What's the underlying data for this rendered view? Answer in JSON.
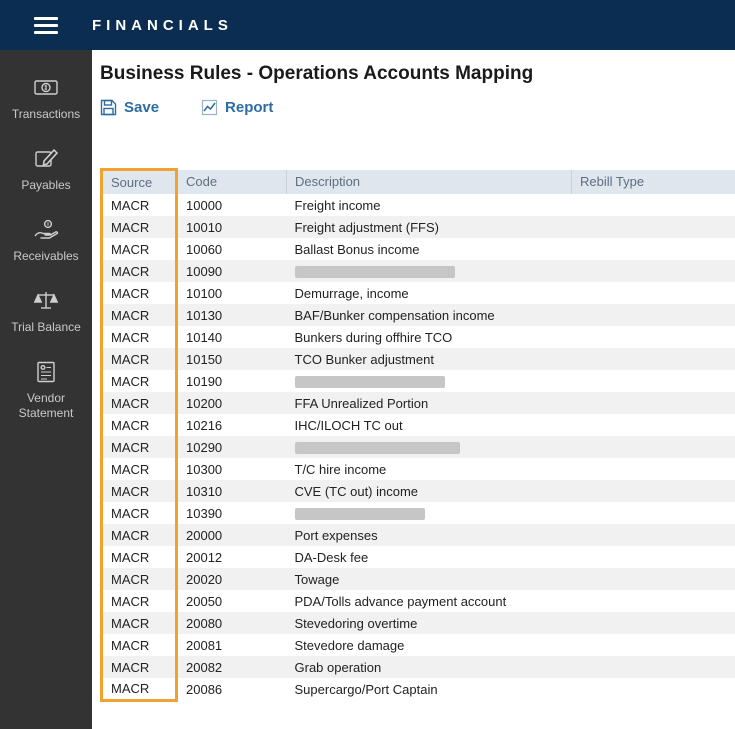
{
  "topbar": {
    "title": "FINANCIALS"
  },
  "sidebar": {
    "items": [
      {
        "label": "Transactions",
        "icon": "transactions-money-icon"
      },
      {
        "label": "Payables",
        "icon": "payables-edit-icon"
      },
      {
        "label": "Receivables",
        "icon": "receivables-hand-coin-icon"
      },
      {
        "label": "Trial Balance",
        "icon": "trial-balance-scale-icon"
      },
      {
        "label": "Vendor Statement",
        "icon": "vendor-statement-document-icon"
      }
    ]
  },
  "main": {
    "title": "Business Rules - Operations Accounts Mapping",
    "toolbar": {
      "save_label": "Save",
      "report_label": "Report"
    },
    "table": {
      "headers": [
        "Source",
        "Code",
        "Description",
        "Rebill Type"
      ],
      "rows": [
        {
          "source": "MACR",
          "code": "10000",
          "description": "Freight income",
          "rebill_type": "",
          "redacted": false
        },
        {
          "source": "MACR",
          "code": "10010",
          "description": "Freight adjustment (FFS)",
          "rebill_type": "",
          "redacted": false
        },
        {
          "source": "MACR",
          "code": "10060",
          "description": "Ballast Bonus income",
          "rebill_type": "",
          "redacted": false
        },
        {
          "source": "MACR",
          "code": "10090",
          "description": "",
          "rebill_type": "",
          "redacted": true,
          "redacted_width": 160
        },
        {
          "source": "MACR",
          "code": "10100",
          "description": "Demurrage, income",
          "rebill_type": "",
          "redacted": false
        },
        {
          "source": "MACR",
          "code": "10130",
          "description": "BAF/Bunker compensation income",
          "rebill_type": "",
          "redacted": false
        },
        {
          "source": "MACR",
          "code": "10140",
          "description": "Bunkers during offhire TCO",
          "rebill_type": "",
          "redacted": false
        },
        {
          "source": "MACR",
          "code": "10150",
          "description": "TCO Bunker adjustment",
          "rebill_type": "",
          "redacted": false
        },
        {
          "source": "MACR",
          "code": "10190",
          "description": "",
          "rebill_type": "",
          "redacted": true,
          "redacted_width": 150
        },
        {
          "source": "MACR",
          "code": "10200",
          "description": "FFA Unrealized Portion",
          "rebill_type": "",
          "redacted": false
        },
        {
          "source": "MACR",
          "code": "10216",
          "description": "IHC/ILOCH TC out",
          "rebill_type": "",
          "redacted": false
        },
        {
          "source": "MACR",
          "code": "10290",
          "description": "",
          "rebill_type": "",
          "redacted": true,
          "redacted_width": 165
        },
        {
          "source": "MACR",
          "code": "10300",
          "description": "T/C hire income",
          "rebill_type": "",
          "redacted": false
        },
        {
          "source": "MACR",
          "code": "10310",
          "description": "CVE (TC out) income",
          "rebill_type": "",
          "redacted": false
        },
        {
          "source": "MACR",
          "code": "10390",
          "description": "",
          "rebill_type": "",
          "redacted": true,
          "redacted_width": 130
        },
        {
          "source": "MACR",
          "code": "20000",
          "description": "Port expenses",
          "rebill_type": "",
          "redacted": false
        },
        {
          "source": "MACR",
          "code": "20012",
          "description": "DA-Desk fee",
          "rebill_type": "",
          "redacted": false
        },
        {
          "source": "MACR",
          "code": "20020",
          "description": "Towage",
          "rebill_type": "",
          "redacted": false
        },
        {
          "source": "MACR",
          "code": "20050",
          "description": "PDA/Tolls advance payment account",
          "rebill_type": "",
          "redacted": false
        },
        {
          "source": "MACR",
          "code": "20080",
          "description": "Stevedoring overtime",
          "rebill_type": "",
          "redacted": false
        },
        {
          "source": "MACR",
          "code": "20081",
          "description": "Stevedore damage",
          "rebill_type": "",
          "redacted": false
        },
        {
          "source": "MACR",
          "code": "20082",
          "description": "Grab operation",
          "rebill_type": "",
          "redacted": false
        },
        {
          "source": "MACR",
          "code": "20086",
          "description": "Supercargo/Port Captain",
          "rebill_type": "",
          "redacted": false
        }
      ]
    }
  },
  "colors": {
    "topbar_bg": "#0c2d52",
    "sidebar_bg": "#333333",
    "header_row_bg": "#e0e6ee",
    "alt_row_bg": "#f1f1f1",
    "link_blue": "#2e6da4",
    "highlight_orange": "#f0a230"
  }
}
